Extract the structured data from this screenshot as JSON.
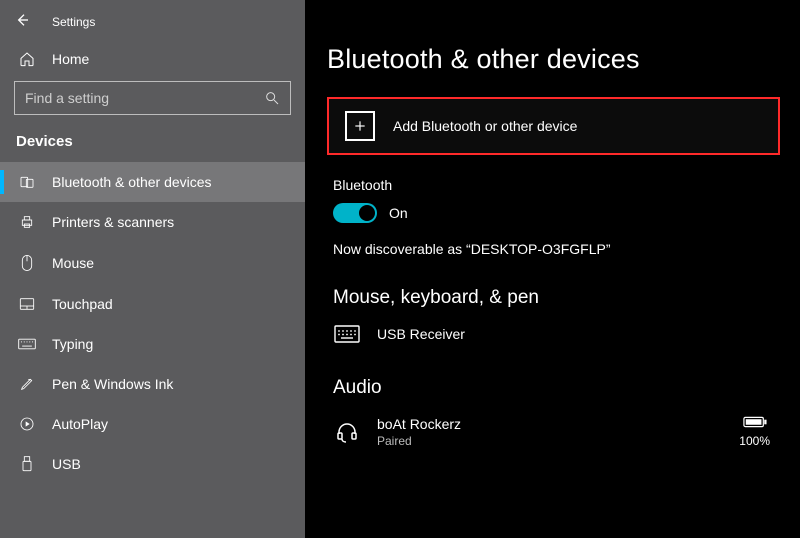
{
  "window": {
    "title": "Settings"
  },
  "sidebar": {
    "home_label": "Home",
    "search": {
      "placeholder": "Find a setting"
    },
    "section_title": "Devices",
    "items": [
      {
        "label": "Bluetooth & other devices",
        "selected": true
      },
      {
        "label": "Printers & scanners"
      },
      {
        "label": "Mouse"
      },
      {
        "label": "Touchpad"
      },
      {
        "label": "Typing"
      },
      {
        "label": "Pen & Windows Ink"
      },
      {
        "label": "AutoPlay"
      },
      {
        "label": "USB"
      }
    ]
  },
  "main": {
    "title": "Bluetooth & other devices",
    "add_device_label": "Add Bluetooth or other device",
    "bluetooth": {
      "label": "Bluetooth",
      "state_text": "On",
      "discoverable_text": "Now discoverable as “DESKTOP-O3FGFLP”"
    },
    "sections": {
      "mouse_keyboard_pen": {
        "heading": "Mouse, keyboard, & pen",
        "devices": [
          {
            "name": "USB Receiver"
          }
        ]
      },
      "audio": {
        "heading": "Audio",
        "devices": [
          {
            "name": "boAt Rockerz",
            "status": "Paired",
            "battery_pct": "100%"
          }
        ]
      }
    }
  }
}
